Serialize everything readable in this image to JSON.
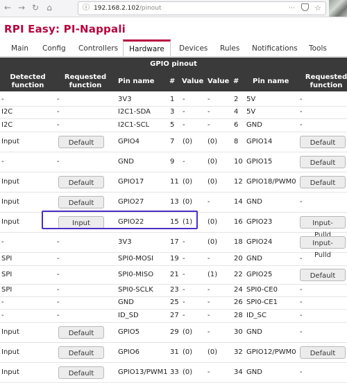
{
  "browser": {
    "url_host": "192.168.2.102",
    "url_path": "/pinout"
  },
  "page": {
    "site_title": "RPI Easy: PI-Nappali"
  },
  "tabs": [
    "Main",
    "Config",
    "Controllers",
    "Hardware",
    "Devices",
    "Rules",
    "Notifications",
    "Tools"
  ],
  "active_tab": "Hardware",
  "table": {
    "caption": "GPIO pinout",
    "headers": {
      "detected": "Detected function",
      "requested": "Requested function",
      "pin_name": "Pin name",
      "num": "#",
      "value": "Value",
      "value2": "Value",
      "num2": "#",
      "pin_name2": "Pin name",
      "requested2": "Requested function"
    },
    "rows": [
      {
        "det": "-",
        "req": "-",
        "name": "3V3",
        "num": "1",
        "val": "-",
        "val2": "-",
        "num2": "2",
        "name2": "5V",
        "req2": "-"
      },
      {
        "det": "I2C",
        "req": "-",
        "name": "I2C1-SDA",
        "num": "3",
        "val": "-",
        "val2": "-",
        "num2": "4",
        "name2": "5V",
        "req2": "-"
      },
      {
        "det": "I2C",
        "req": "-",
        "name": "I2C1-SCL",
        "num": "5",
        "val": "-",
        "val2": "-",
        "num2": "6",
        "name2": "GND",
        "req2": "-"
      },
      {
        "det": "Input",
        "req": "Default",
        "name": "GPIO4",
        "num": "7",
        "val": "(0)",
        "val2": "(0)",
        "num2": "8",
        "name2": "GPIO14",
        "req2": "Default"
      },
      {
        "det": "-",
        "req": "-",
        "name": "GND",
        "num": "9",
        "val": "-",
        "val2": "(0)",
        "num2": "10",
        "name2": "GPIO15",
        "req2": "Default"
      },
      {
        "det": "Input",
        "req": "Default",
        "name": "GPIO17",
        "num": "11",
        "val": "(0)",
        "val2": "(0)",
        "num2": "12",
        "name2": "GPIO18/PWM0",
        "req2": "Default"
      },
      {
        "det": "Input",
        "req": "Default",
        "name": "GPIO27",
        "num": "13",
        "val": "(0)",
        "val2": "-",
        "num2": "14",
        "name2": "GND",
        "req2": "-"
      },
      {
        "det": "Input",
        "req": "Input",
        "name": "GPIO22",
        "num": "15",
        "val": "(1)",
        "val2": "(0)",
        "num2": "16",
        "name2": "GPIO23",
        "req2": "Input-Pulld"
      },
      {
        "det": "-",
        "req": "-",
        "name": "3V3",
        "num": "17",
        "val": "-",
        "val2": "(0)",
        "num2": "18",
        "name2": "GPIO24",
        "req2": "Input-Pulld"
      },
      {
        "det": "SPI",
        "req": "-",
        "name": "SPI0-MOSI",
        "num": "19",
        "val": "-",
        "val2": "-",
        "num2": "20",
        "name2": "GND",
        "req2": "-"
      },
      {
        "det": "SPI",
        "req": "-",
        "name": "SPI0-MISO",
        "num": "21",
        "val": "-",
        "val2": "(1)",
        "num2": "22",
        "name2": "GPIO25",
        "req2": "Default"
      },
      {
        "det": "SPI",
        "req": "-",
        "name": "SPI0-SCLK",
        "num": "23",
        "val": "-",
        "val2": "-",
        "num2": "24",
        "name2": "SPI0-CE0",
        "req2": "-"
      },
      {
        "det": "-",
        "req": "-",
        "name": "GND",
        "num": "25",
        "val": "-",
        "val2": "-",
        "num2": "26",
        "name2": "SPI0-CE1",
        "req2": "-"
      },
      {
        "det": "-",
        "req": "-",
        "name": "ID_SD",
        "num": "27",
        "val": "-",
        "val2": "-",
        "num2": "28",
        "name2": "ID_SC",
        "req2": "-"
      },
      {
        "det": "Input",
        "req": "Default",
        "name": "GPIO5",
        "num": "29",
        "val": "(0)",
        "val2": "-",
        "num2": "30",
        "name2": "GND",
        "req2": "-"
      },
      {
        "det": "Input",
        "req": "Default",
        "name": "GPIO6",
        "num": "31",
        "val": "(0)",
        "val2": "(0)",
        "num2": "32",
        "name2": "GPIO12/PWM0",
        "req2": "Default"
      },
      {
        "det": "Input",
        "req": "Default",
        "name": "GPIO13/PWM1",
        "num": "33",
        "val": "(0)",
        "val2": "-",
        "num2": "34",
        "name2": "GND",
        "req2": "-"
      }
    ]
  }
}
